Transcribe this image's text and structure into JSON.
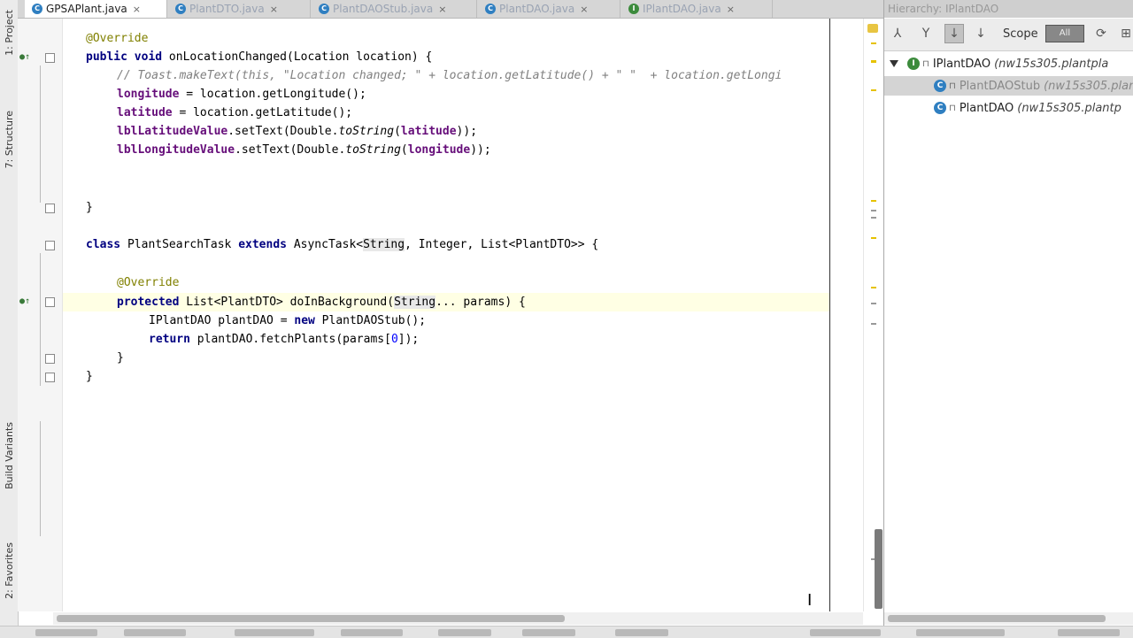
{
  "editor_tabs": [
    {
      "label": "GPSAPlant.java",
      "active": true
    },
    {
      "label": "PlantDTO.java",
      "active": false
    },
    {
      "label": "PlantDAOStub.java",
      "active": false
    },
    {
      "label": "PlantDAO.java",
      "active": false
    },
    {
      "label": "IPlantDAO.java",
      "active": false
    }
  ],
  "tab_close_glyph": "×",
  "left_tool_tabs": [
    {
      "label": "1: Project"
    },
    {
      "label": "7: Structure"
    },
    {
      "label": "Build Variants"
    },
    {
      "label": "2: Favorites"
    }
  ],
  "code": {
    "l1_annotation": "@Override",
    "l2_public": "public",
    "l2_void": "void",
    "l2_rest": " onLocationChanged(Location location) {",
    "l3_comment": "// Toast.makeText(this, \"Location changed; \" + location.getLatitude() + \" \"  + location.getLongi",
    "l4_field": "longitude",
    "l4_rest": " = location.getLongitude();",
    "l5_field": "latitude",
    "l5_rest": " = location.getLatitude();",
    "l6_field": "lblLatitudeValue",
    "l6_mid": ".setText(Double.",
    "l6_static": "toString",
    "l6_arg_open": "(",
    "l6_arg": "latitude",
    "l6_end": "));",
    "l7_field": "lblLongitudeValue",
    "l7_mid": ".setText(Double.",
    "l7_static": "toString",
    "l7_arg_open": "(",
    "l7_arg": "longitude",
    "l7_end": "));",
    "l8_brace": "}",
    "l9_class": "class",
    "l9_name": " PlantSearchTask ",
    "l9_extends": "extends",
    "l9_a": " AsyncTask<",
    "l9_string": "String",
    "l9_b": ", Integer, List<PlantDTO>> {",
    "l10_annotation": "@Override",
    "l11_protected": "protected",
    "l11_a": " List<PlantDTO> doInBackground(",
    "l11_string": "String",
    "l11_b": "... params) {",
    "l12_a": "IPlantDAO plantDAO = ",
    "l12_new": "new",
    "l12_b": " PlantDAOStub();",
    "l13_return": "return",
    "l13_a": " plantDAO.fetchPlants(params[",
    "l13_num": "0",
    "l13_b": "]);",
    "l14_brace": "}",
    "l15_brace": "}",
    "l16_brace": "}"
  },
  "hierarchy_panel": {
    "title": "Hierarchy: IPlantDAO",
    "scope_label": "Scope",
    "scope_value": "All",
    "tree": [
      {
        "icon": "I",
        "name": "IPlantDAO",
        "package": "(nw15s305.plantpla",
        "selected": false
      },
      {
        "icon": "C",
        "name": "PlantDAOStub",
        "package": "(nw15s305.plan",
        "selected": true
      },
      {
        "icon": "C",
        "name": "PlantDAO",
        "package": "(nw15s305.plantp",
        "selected": false
      }
    ]
  }
}
